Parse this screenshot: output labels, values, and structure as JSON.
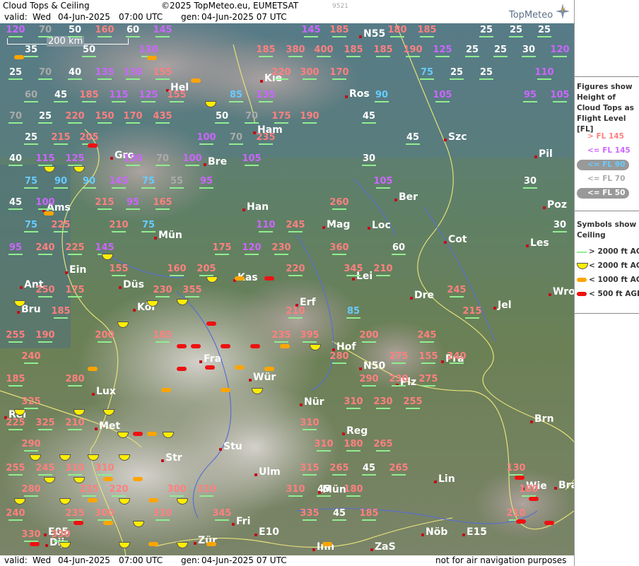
{
  "header": {
    "title": "Cloud Tops & Ceiling",
    "copyright": "©2025 TopMeteo.eu, EUMETSAT",
    "valid_label": "valid:",
    "valid_day": "Wed",
    "valid_date": "04-Jun-2025",
    "valid_time": "07:00 UTC",
    "gen_label": "gen:",
    "gen_value": "04-Jun-2025 07 UTC",
    "map_id": "9521",
    "brand": "TopMeteo"
  },
  "footer": {
    "valid_label": "valid:",
    "valid_day": "Wed",
    "valid_date": "04-Jun-2025",
    "valid_time": "07:00 UTC",
    "gen_label": "gen:",
    "gen_value": "04-Jun-2025 07 UTC",
    "disclaimer": "not for air navigation purposes"
  },
  "scale_bar": "200 km",
  "legend": {
    "figures_title": "Figures show Height of Cloud Tops as Flight Level [FL]",
    "fl_items": [
      {
        "label": "> FL 145",
        "color": "#ff8080"
      },
      {
        "label": "<= FL 145",
        "color": "#cc66ff"
      },
      {
        "label": "<= FL 90",
        "color": "#66ccff"
      },
      {
        "label": "<= FL 70",
        "color": "#aaaaaa"
      },
      {
        "label": "<= FL 50",
        "color": "#ffffff"
      }
    ],
    "symbols_title": "Symbols show Ceiling",
    "symbol_items": [
      {
        "label": "> 2000 ft AGL",
        "type": "line",
        "color": "#90ee90"
      },
      {
        "label": "< 2000 ft AGL",
        "type": "half",
        "color": "#ffee00"
      },
      {
        "label": "< 1000 ft AGL",
        "type": "dash",
        "color": "#ffa500"
      },
      {
        "label": "< 500 ft AGL",
        "type": "dash",
        "color": "#ee1111"
      }
    ]
  },
  "cities": [
    {
      "name": "N55"
    },
    {
      "name": "Kie"
    },
    {
      "name": "Hel"
    },
    {
      "name": "Ros"
    },
    {
      "name": "Ham"
    },
    {
      "name": "Szc"
    },
    {
      "name": "Gro"
    },
    {
      "name": "Bre"
    },
    {
      "name": "Pil"
    },
    {
      "name": "Ams"
    },
    {
      "name": "Han"
    },
    {
      "name": "Ber"
    },
    {
      "name": "Poz"
    },
    {
      "name": "Mag"
    },
    {
      "name": "Loc"
    },
    {
      "name": "Mün"
    },
    {
      "name": "Cot"
    },
    {
      "name": "Les"
    },
    {
      "name": "Ein"
    },
    {
      "name": "Kas"
    },
    {
      "name": "Lei"
    },
    {
      "name": "Ant"
    },
    {
      "name": "Düs"
    },
    {
      "name": "Bru"
    },
    {
      "name": "Erf"
    },
    {
      "name": "Dre"
    },
    {
      "name": "Wro"
    },
    {
      "name": "Köl"
    },
    {
      "name": "Jel"
    },
    {
      "name": "Hof"
    },
    {
      "name": "Fra"
    },
    {
      "name": "N50"
    },
    {
      "name": "Pra"
    },
    {
      "name": "Lux"
    },
    {
      "name": "Wür"
    },
    {
      "name": "Plz"
    },
    {
      "name": "Nür"
    },
    {
      "name": "Rei"
    },
    {
      "name": "Met"
    },
    {
      "name": "Reg"
    },
    {
      "name": "Brn"
    },
    {
      "name": "Stu"
    },
    {
      "name": "Str"
    },
    {
      "name": "Ulm"
    },
    {
      "name": "Lin"
    },
    {
      "name": "Mün"
    },
    {
      "name": "Wie"
    },
    {
      "name": "Bra"
    },
    {
      "name": "Fri"
    },
    {
      "name": "E10"
    },
    {
      "name": "E05"
    },
    {
      "name": "Nöb"
    },
    {
      "name": "E15"
    },
    {
      "name": "Dij"
    },
    {
      "name": "Zür"
    },
    {
      "name": "Inn"
    },
    {
      "name": "ZaS"
    }
  ],
  "cloud_tops": [
    {
      "v": "120",
      "c": "#cc66ff"
    },
    {
      "v": "70",
      "c": "#aaaaaa"
    },
    {
      "v": "50",
      "c": "#ffffff"
    },
    {
      "v": "160",
      "c": "#ff8080"
    },
    {
      "v": "60",
      "c": "#ffffff"
    },
    {
      "v": "145",
      "c": "#cc66ff"
    },
    {
      "v": "145",
      "c": "#cc66ff"
    },
    {
      "v": "185",
      "c": "#ff8080"
    },
    {
      "v": "180",
      "c": "#ff8080"
    },
    {
      "v": "185",
      "c": "#ff8080"
    },
    {
      "v": "25",
      "c": "#ffffff"
    },
    {
      "v": "25",
      "c": "#ffffff"
    },
    {
      "v": "25",
      "c": "#ffffff"
    },
    {
      "v": "35",
      "c": "#ffffff"
    },
    {
      "v": "50",
      "c": "#ffffff"
    },
    {
      "v": "130",
      "c": "#cc66ff"
    },
    {
      "v": "185",
      "c": "#ff8080"
    },
    {
      "v": "380",
      "c": "#ff8080"
    },
    {
      "v": "400",
      "c": "#ff8080"
    },
    {
      "v": "185",
      "c": "#ff8080"
    },
    {
      "v": "185",
      "c": "#ff8080"
    },
    {
      "v": "190",
      "c": "#ff8080"
    },
    {
      "v": "125",
      "c": "#cc66ff"
    },
    {
      "v": "25",
      "c": "#ffffff"
    },
    {
      "v": "25",
      "c": "#ffffff"
    },
    {
      "v": "30",
      "c": "#ffffff"
    },
    {
      "v": "120",
      "c": "#cc66ff"
    },
    {
      "v": "25",
      "c": "#ffffff"
    },
    {
      "v": "70",
      "c": "#aaaaaa"
    },
    {
      "v": "40",
      "c": "#ffffff"
    },
    {
      "v": "135",
      "c": "#cc66ff"
    },
    {
      "v": "130",
      "c": "#cc66ff"
    },
    {
      "v": "155",
      "c": "#ff8080"
    },
    {
      "v": "220",
      "c": "#ff8080"
    },
    {
      "v": "300",
      "c": "#ff8080"
    },
    {
      "v": "170",
      "c": "#ff8080"
    },
    {
      "v": "75",
      "c": "#66ccff"
    },
    {
      "v": "25",
      "c": "#ffffff"
    },
    {
      "v": "25",
      "c": "#ffffff"
    },
    {
      "v": "110",
      "c": "#cc66ff"
    },
    {
      "v": "60",
      "c": "#aaaaaa"
    },
    {
      "v": "45",
      "c": "#ffffff"
    },
    {
      "v": "185",
      "c": "#ff8080"
    },
    {
      "v": "115",
      "c": "#cc66ff"
    },
    {
      "v": "125",
      "c": "#cc66ff"
    },
    {
      "v": "155",
      "c": "#ff8080"
    },
    {
      "v": "85",
      "c": "#66ccff"
    },
    {
      "v": "135",
      "c": "#cc66ff"
    },
    {
      "v": "90",
      "c": "#66ccff"
    },
    {
      "v": "105",
      "c": "#cc66ff"
    },
    {
      "v": "95",
      "c": "#cc66ff"
    },
    {
      "v": "105",
      "c": "#cc66ff"
    },
    {
      "v": "70",
      "c": "#aaaaaa"
    },
    {
      "v": "25",
      "c": "#ffffff"
    },
    {
      "v": "220",
      "c": "#ff8080"
    },
    {
      "v": "150",
      "c": "#ff8080"
    },
    {
      "v": "170",
      "c": "#ff8080"
    },
    {
      "v": "435",
      "c": "#ff8080"
    },
    {
      "v": "50",
      "c": "#ffffff"
    },
    {
      "v": "70",
      "c": "#aaaaaa"
    },
    {
      "v": "175",
      "c": "#ff8080"
    },
    {
      "v": "190",
      "c": "#ff8080"
    },
    {
      "v": "45",
      "c": "#ffffff"
    },
    {
      "v": "25",
      "c": "#ffffff"
    },
    {
      "v": "215",
      "c": "#ff8080"
    },
    {
      "v": "205",
      "c": "#ff8080"
    },
    {
      "v": "100",
      "c": "#cc66ff"
    },
    {
      "v": "70",
      "c": "#aaaaaa"
    },
    {
      "v": "235",
      "c": "#ff8080"
    },
    {
      "v": "45",
      "c": "#ffffff"
    },
    {
      "v": "40",
      "c": "#ffffff"
    },
    {
      "v": "115",
      "c": "#cc66ff"
    },
    {
      "v": "125",
      "c": "#cc66ff"
    },
    {
      "v": "130",
      "c": "#cc66ff"
    },
    {
      "v": "70",
      "c": "#aaaaaa"
    },
    {
      "v": "100",
      "c": "#cc66ff"
    },
    {
      "v": "105",
      "c": "#cc66ff"
    },
    {
      "v": "30",
      "c": "#ffffff"
    },
    {
      "v": "75",
      "c": "#66ccff"
    },
    {
      "v": "90",
      "c": "#66ccff"
    },
    {
      "v": "90",
      "c": "#66ccff"
    },
    {
      "v": "145",
      "c": "#cc66ff"
    },
    {
      "v": "75",
      "c": "#66ccff"
    },
    {
      "v": "55",
      "c": "#aaaaaa"
    },
    {
      "v": "95",
      "c": "#cc66ff"
    },
    {
      "v": "105",
      "c": "#cc66ff"
    },
    {
      "v": "30",
      "c": "#ffffff"
    },
    {
      "v": "45",
      "c": "#ffffff"
    },
    {
      "v": "100",
      "c": "#cc66ff"
    },
    {
      "v": "215",
      "c": "#ff8080"
    },
    {
      "v": "95",
      "c": "#cc66ff"
    },
    {
      "v": "165",
      "c": "#ff8080"
    },
    {
      "v": "260",
      "c": "#ff8080"
    },
    {
      "v": "75",
      "c": "#66ccff"
    },
    {
      "v": "225",
      "c": "#ff8080"
    },
    {
      "v": "210",
      "c": "#ff8080"
    },
    {
      "v": "75",
      "c": "#66ccff"
    },
    {
      "v": "110",
      "c": "#cc66ff"
    },
    {
      "v": "245",
      "c": "#ff8080"
    },
    {
      "v": "30",
      "c": "#ffffff"
    },
    {
      "v": "95",
      "c": "#cc66ff"
    },
    {
      "v": "240",
      "c": "#ff8080"
    },
    {
      "v": "225",
      "c": "#ff8080"
    },
    {
      "v": "145",
      "c": "#cc66ff"
    },
    {
      "v": "175",
      "c": "#ff8080"
    },
    {
      "v": "120",
      "c": "#cc66ff"
    },
    {
      "v": "230",
      "c": "#ff8080"
    },
    {
      "v": "360",
      "c": "#ff8080"
    },
    {
      "v": "60",
      "c": "#ffffff"
    },
    {
      "v": "155",
      "c": "#ff8080"
    },
    {
      "v": "160",
      "c": "#ff8080"
    },
    {
      "v": "205",
      "c": "#ff8080"
    },
    {
      "v": "220",
      "c": "#ff8080"
    },
    {
      "v": "345",
      "c": "#ff8080"
    },
    {
      "v": "210",
      "c": "#ff8080"
    },
    {
      "v": "250",
      "c": "#ff8080"
    },
    {
      "v": "175",
      "c": "#ff8080"
    },
    {
      "v": "230",
      "c": "#ff8080"
    },
    {
      "v": "355",
      "c": "#ff8080"
    },
    {
      "v": "245",
      "c": "#ff8080"
    },
    {
      "v": "185",
      "c": "#ff8080"
    },
    {
      "v": "210",
      "c": "#ff8080"
    },
    {
      "v": "85",
      "c": "#66ccff"
    },
    {
      "v": "215",
      "c": "#ff8080"
    },
    {
      "v": "255",
      "c": "#ff8080"
    },
    {
      "v": "190",
      "c": "#ff8080"
    },
    {
      "v": "200",
      "c": "#ff8080"
    },
    {
      "v": "185",
      "c": "#ff8080"
    },
    {
      "v": "235",
      "c": "#ff8080"
    },
    {
      "v": "395",
      "c": "#ff8080"
    },
    {
      "v": "200",
      "c": "#ff8080"
    },
    {
      "v": "245",
      "c": "#ff8080"
    },
    {
      "v": "240",
      "c": "#ff8080"
    },
    {
      "v": "280",
      "c": "#ff8080"
    },
    {
      "v": "275",
      "c": "#ff8080"
    },
    {
      "v": "155",
      "c": "#ff8080"
    },
    {
      "v": "240",
      "c": "#ff8080"
    },
    {
      "v": "185",
      "c": "#ff8080"
    },
    {
      "v": "280",
      "c": "#ff8080"
    },
    {
      "v": "290",
      "c": "#ff8080"
    },
    {
      "v": "230",
      "c": "#ff8080"
    },
    {
      "v": "275",
      "c": "#ff8080"
    },
    {
      "v": "325",
      "c": "#ff8080"
    },
    {
      "v": "310",
      "c": "#ff8080"
    },
    {
      "v": "230",
      "c": "#ff8080"
    },
    {
      "v": "255",
      "c": "#ff8080"
    },
    {
      "v": "225",
      "c": "#ff8080"
    },
    {
      "v": "325",
      "c": "#ff8080"
    },
    {
      "v": "210",
      "c": "#ff8080"
    },
    {
      "v": "310",
      "c": "#ff8080"
    },
    {
      "v": "290",
      "c": "#ff8080"
    },
    {
      "v": "310",
      "c": "#ff8080"
    },
    {
      "v": "180",
      "c": "#ff8080"
    },
    {
      "v": "265",
      "c": "#ff8080"
    },
    {
      "v": "255",
      "c": "#ff8080"
    },
    {
      "v": "245",
      "c": "#ff8080"
    },
    {
      "v": "310",
      "c": "#ff8080"
    },
    {
      "v": "310",
      "c": "#ff8080"
    },
    {
      "v": "315",
      "c": "#ff8080"
    },
    {
      "v": "265",
      "c": "#ff8080"
    },
    {
      "v": "45",
      "c": "#ffffff"
    },
    {
      "v": "265",
      "c": "#ff8080"
    },
    {
      "v": "130",
      "c": "#ff8080"
    },
    {
      "v": "280",
      "c": "#ff8080"
    },
    {
      "v": "235",
      "c": "#ff8080"
    },
    {
      "v": "220",
      "c": "#ff8080"
    },
    {
      "v": "300",
      "c": "#ff8080"
    },
    {
      "v": "310",
      "c": "#ff8080"
    },
    {
      "v": "310",
      "c": "#ff8080"
    },
    {
      "v": "45",
      "c": "#ffffff"
    },
    {
      "v": "180",
      "c": "#ff8080"
    },
    {
      "v": "180",
      "c": "#ff8080"
    },
    {
      "v": "240",
      "c": "#ff8080"
    },
    {
      "v": "235",
      "c": "#ff8080"
    },
    {
      "v": "300",
      "c": "#ff8080"
    },
    {
      "v": "310",
      "c": "#ff8080"
    },
    {
      "v": "345",
      "c": "#ff8080"
    },
    {
      "v": "335",
      "c": "#ff8080"
    },
    {
      "v": "45",
      "c": "#ffffff"
    },
    {
      "v": "185",
      "c": "#ff8080"
    },
    {
      "v": "210",
      "c": "#ff8080"
    },
    {
      "v": "330",
      "c": "#ff8080"
    },
    {
      "v": "330",
      "c": "#ff8080"
    }
  ]
}
